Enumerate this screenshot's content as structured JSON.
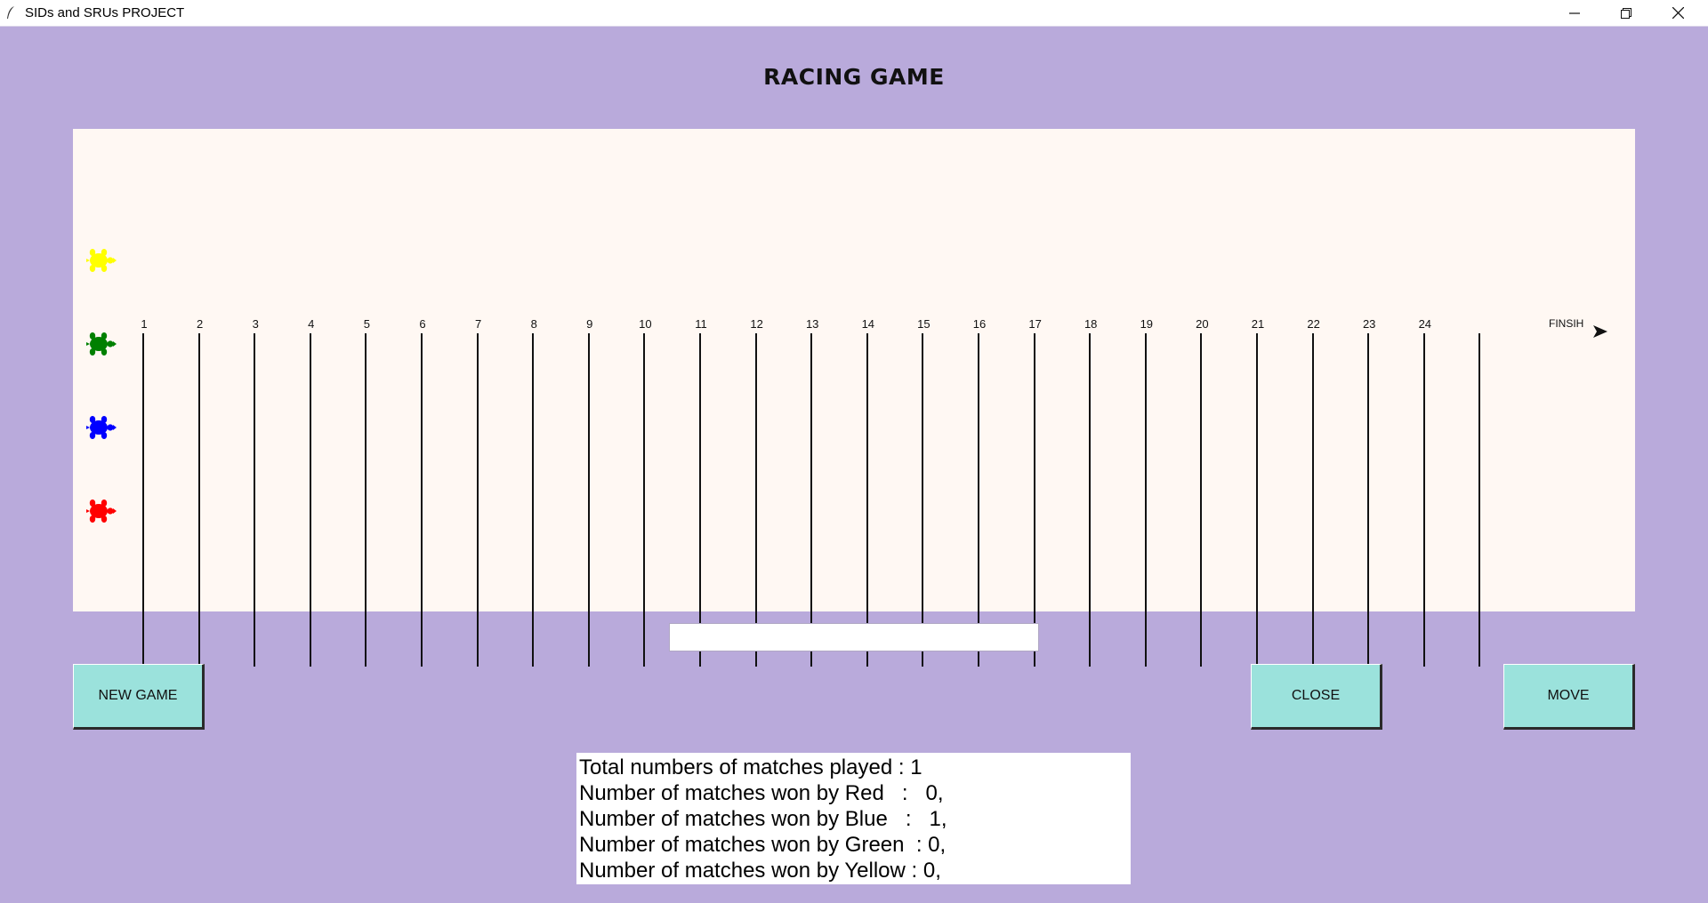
{
  "window": {
    "title": "SIDs and SRUs PROJECT"
  },
  "game": {
    "title": "RACING GAME"
  },
  "track": {
    "lane_numbers": [
      "1",
      "2",
      "3",
      "4",
      "5",
      "6",
      "7",
      "8",
      "9",
      "10",
      "11",
      "12",
      "13",
      "14",
      "15",
      "16",
      "17",
      "18",
      "19",
      "20",
      "21",
      "22",
      "23",
      "24"
    ],
    "finish_label": "FINSIH"
  },
  "turtles": [
    {
      "name": "yellow",
      "color": "#ffff00"
    },
    {
      "name": "green",
      "color": "#008000"
    },
    {
      "name": "blue",
      "color": "#0000ff"
    },
    {
      "name": "red",
      "color": "#ff0000"
    }
  ],
  "entry": {
    "value": ""
  },
  "buttons": {
    "new_game": "NEW GAME",
    "close": "CLOSE",
    "move": "MOVE"
  },
  "stats": {
    "total": "Total numbers of matches played : 1",
    "red": "Number of matches won by Red   :   0,",
    "blue": "Number of matches won by Blue   :   1,",
    "green": "Number of matches won by Green  : 0,",
    "yellow": "Number of matches won by Yellow : 0,"
  },
  "colors": {
    "background": "#b9aadb",
    "canvas": "#fff8f3",
    "button": "#9be2dc"
  }
}
